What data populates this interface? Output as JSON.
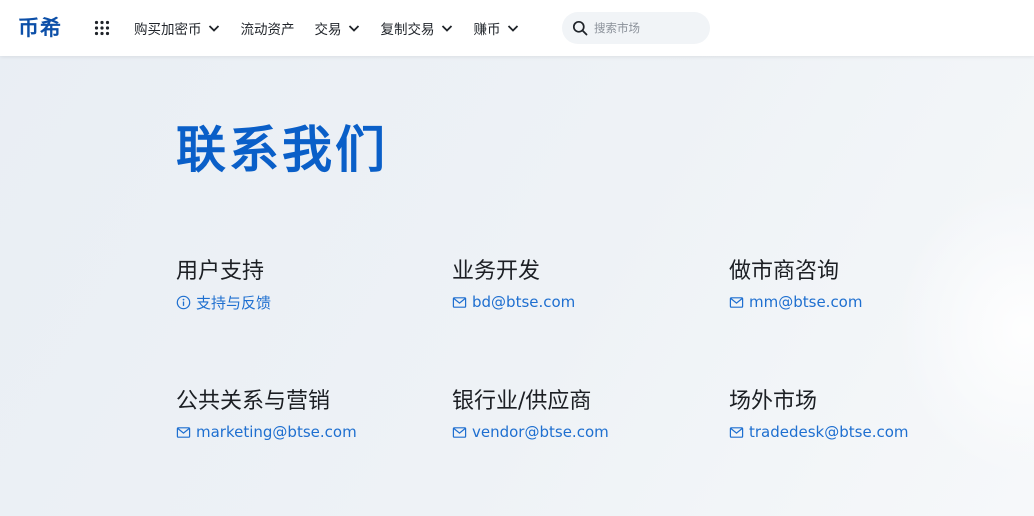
{
  "header": {
    "logo_text": "币希",
    "nav": [
      {
        "label": "购买加密币",
        "has_dropdown": true
      },
      {
        "label": "流动资产",
        "has_dropdown": false
      },
      {
        "label": "交易",
        "has_dropdown": true
      },
      {
        "label": "复制交易",
        "has_dropdown": true
      },
      {
        "label": "赚币",
        "has_dropdown": true
      }
    ],
    "search": {
      "placeholder": "搜索市场",
      "value": ""
    }
  },
  "main": {
    "title": "联系我们",
    "contacts": [
      {
        "title": "用户支持",
        "link": "支持与反馈",
        "icon": "info-icon"
      },
      {
        "title": "业务开发",
        "link": "bd@btse.com",
        "icon": "mail-icon"
      },
      {
        "title": "做市商咨询",
        "link": "mm@btse.com",
        "icon": "mail-icon"
      },
      {
        "title": "公共关系与营销",
        "link": "marketing@btse.com",
        "icon": "mail-icon"
      },
      {
        "title": "银行业/供应商",
        "link": "vendor@btse.com",
        "icon": "mail-icon"
      },
      {
        "title": "场外市场",
        "link": "tradedesk@btse.com",
        "icon": "mail-icon"
      }
    ]
  },
  "colors": {
    "brand": "#0c4fa8",
    "title_blue": "#0a5fc8",
    "link_blue": "#1e6fd0",
    "text_dark": "#1c1f24",
    "background": "#eef2f7"
  }
}
